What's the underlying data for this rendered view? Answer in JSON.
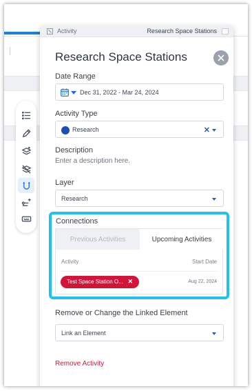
{
  "panel": {
    "header_label": "Activity",
    "header_title": "Research Space Stations",
    "title": "Research Space Stations"
  },
  "date_range": {
    "label": "Date Range",
    "value": "Dec 31, 2022 - Mar 24, 2024"
  },
  "activity_type": {
    "label": "Activity Type",
    "value": "Research",
    "dot_color": "#1a4fb3",
    "clear_symbol": "✕"
  },
  "description": {
    "label": "Description",
    "placeholder": "Enter a description here."
  },
  "layer": {
    "label": "Layer",
    "value": "Research"
  },
  "connections": {
    "label": "Connections",
    "tabs": [
      "Previous Activities",
      "Upcoming Activities"
    ],
    "active_tab": "Upcoming Activities",
    "columns": [
      "Activity",
      "Start Date"
    ],
    "rows": [
      {
        "activity": "Test Space Station O...",
        "start_date": "Aug 22, 2024",
        "remove_symbol": "✕"
      }
    ],
    "highlight_color": "#1ec2ec"
  },
  "linked_element": {
    "label": "Remove or Change the Linked Element",
    "placeholder": "Link an Element"
  },
  "remove_activity": "Remove Activity",
  "toolbar": {
    "tools": [
      "list-icon",
      "pencil-icon",
      "layers-add-icon",
      "layers-hidden-icon",
      "magnet-icon",
      "path-add-icon",
      "keyboard-icon"
    ],
    "active_tool": "magnet-icon"
  },
  "colors": {
    "accent": "#1f6fd0",
    "danger": "#d2143a"
  }
}
